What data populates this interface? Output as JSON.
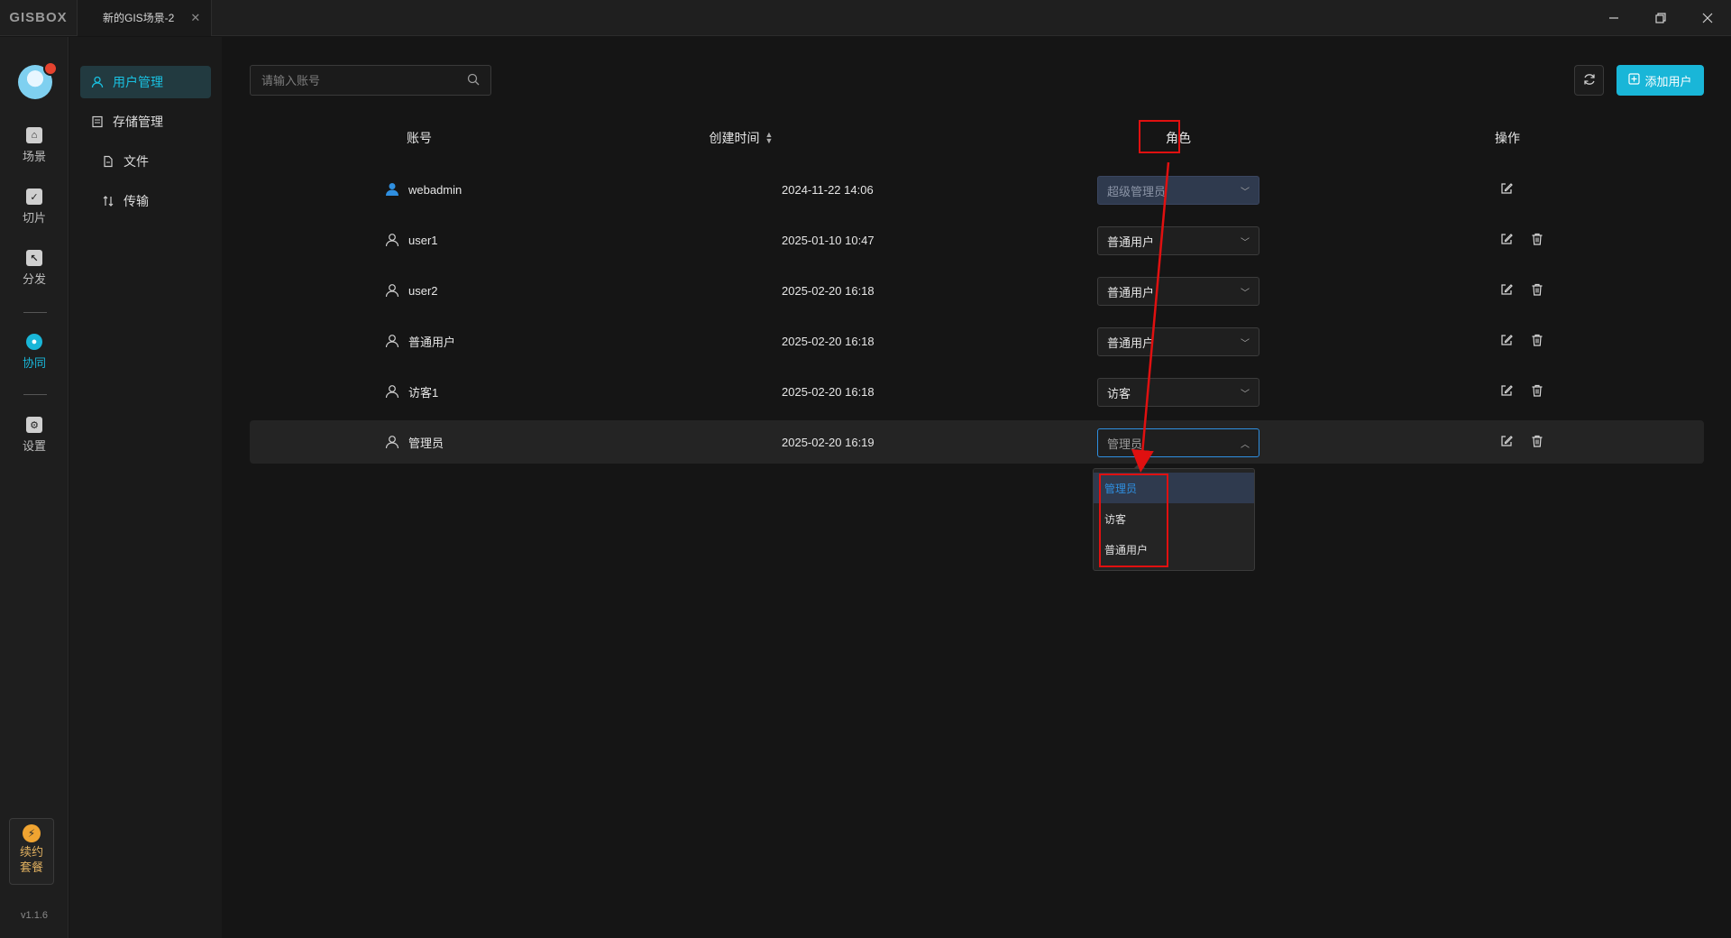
{
  "app": {
    "logo": "GISBOX",
    "tab_title": "新的GIS场景-2",
    "version": "v1.1.6"
  },
  "rail": {
    "items": [
      {
        "label": "场景",
        "icon": "scene-icon"
      },
      {
        "label": "切片",
        "icon": "slice-icon"
      },
      {
        "label": "分发",
        "icon": "distribute-icon"
      },
      {
        "label": "协同",
        "icon": "collab-icon",
        "active": true
      },
      {
        "label": "设置",
        "icon": "settings-icon"
      }
    ],
    "renew_line1": "续约",
    "renew_line2": "套餐"
  },
  "subnav": {
    "items": [
      {
        "label": "用户管理",
        "active": true
      },
      {
        "label": "存储管理"
      },
      {
        "label": "文件"
      },
      {
        "label": "传输"
      }
    ]
  },
  "toolbar": {
    "search_placeholder": "请输入账号",
    "add_user_label": "添加用户"
  },
  "table": {
    "headers": {
      "account": "账号",
      "created": "创建时间",
      "role": "角色",
      "actions": "操作"
    },
    "rows": [
      {
        "account": "webadmin",
        "created": "2024-11-22 14:06",
        "role": "超级管理员",
        "deletable": false
      },
      {
        "account": "user1",
        "created": "2025-01-10 10:47",
        "role": "普通用户",
        "deletable": true
      },
      {
        "account": "user2",
        "created": "2025-02-20 16:18",
        "role": "普通用户",
        "deletable": true
      },
      {
        "account": "普通用户",
        "created": "2025-02-20 16:18",
        "role": "普通用户",
        "deletable": true
      },
      {
        "account": "访客1",
        "created": "2025-02-20 16:18",
        "role": "访客",
        "deletable": true
      },
      {
        "account": "管理员",
        "created": "2025-02-20 16:19",
        "role": "管理员",
        "deletable": true
      }
    ]
  },
  "role_dropdown": {
    "options": [
      "管理员",
      "访客",
      "普通用户"
    ],
    "selected": "管理员"
  },
  "colors": {
    "accent": "#19b6d8",
    "annotation": "#e01010",
    "select_focus": "#2f8fe0"
  }
}
